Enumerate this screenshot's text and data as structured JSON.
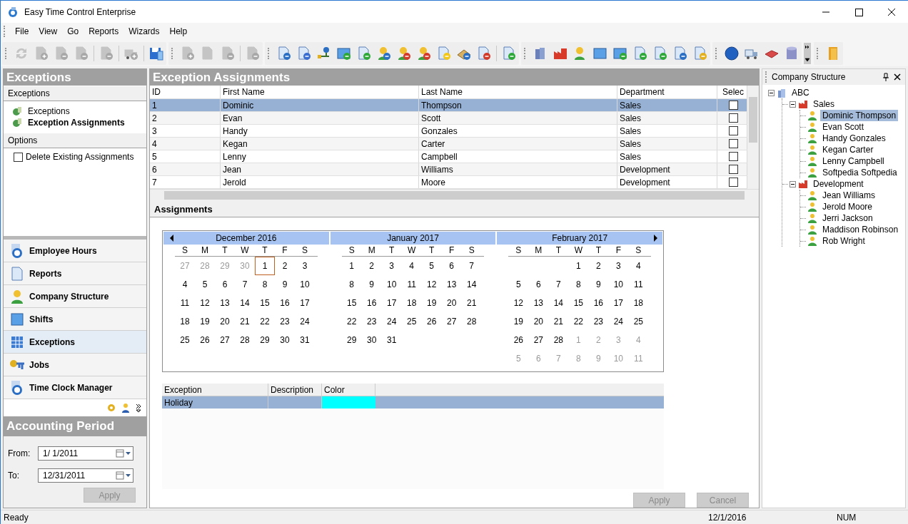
{
  "window": {
    "title": "Easy Time Control Enterprise"
  },
  "menu": [
    "File",
    "View",
    "Go",
    "Reports",
    "Wizards",
    "Help"
  ],
  "left_panel": {
    "title": "Exceptions",
    "sections": [
      {
        "title": "Exceptions",
        "items": [
          {
            "label": "Exceptions",
            "selected": false
          },
          {
            "label": "Exception Assignments",
            "selected": true
          }
        ]
      }
    ],
    "options_title": "Options",
    "options": [
      {
        "label": "Delete Existing Assignments",
        "checked": false
      }
    ],
    "nav": [
      {
        "label": "Employee Hours",
        "kind": "clock",
        "selected": false
      },
      {
        "label": "Reports",
        "kind": "document",
        "selected": false
      },
      {
        "label": "Company Structure",
        "kind": "person",
        "selected": false
      },
      {
        "label": "Shifts",
        "kind": "calendar",
        "selected": false
      },
      {
        "label": "Exceptions",
        "kind": "grid",
        "selected": true
      },
      {
        "label": "Jobs",
        "kind": "key",
        "selected": false
      },
      {
        "label": "Time Clock Manager",
        "kind": "clock",
        "selected": false
      }
    ],
    "accounting": {
      "title": "Accounting Period",
      "from_label": "From:",
      "from": "1/  1/2011",
      "to_label": "To:",
      "to": "12/31/2011",
      "apply": "Apply",
      "apply_disabled": true
    }
  },
  "center": {
    "title": "Exception Assignments",
    "columns": [
      "ID",
      "First Name",
      "Last Name",
      "Department",
      "Selec"
    ],
    "rows": [
      {
        "id": "1",
        "first": "Dominic",
        "last": "Thompson",
        "dept": "Sales",
        "checked": false,
        "selected": true
      },
      {
        "id": "2",
        "first": "Evan",
        "last": "Scott",
        "dept": "Sales",
        "checked": false,
        "selected": false
      },
      {
        "id": "3",
        "first": "Handy",
        "last": "Gonzales",
        "dept": "Sales",
        "checked": false,
        "selected": false
      },
      {
        "id": "4",
        "first": "Kegan",
        "last": "Carter",
        "dept": "Sales",
        "checked": false,
        "selected": false
      },
      {
        "id": "5",
        "first": "Lenny",
        "last": "Campbell",
        "dept": "Sales",
        "checked": false,
        "selected": false
      },
      {
        "id": "6",
        "first": "Jean",
        "last": "Williams",
        "dept": "Development",
        "checked": false,
        "selected": false
      },
      {
        "id": "7",
        "first": "Jerold",
        "last": "Moore",
        "dept": "Development",
        "checked": false,
        "selected": false
      }
    ],
    "assignments_title": "Assignments",
    "months": [
      {
        "title": "December 2016",
        "days": [
          "S",
          "M",
          "T",
          "W",
          "T",
          "F",
          "S"
        ],
        "weeks": [
          [
            {
              "d": "27",
              "other": true,
              "today": false
            },
            {
              "d": "28",
              "other": true,
              "today": false
            },
            {
              "d": "29",
              "other": true,
              "today": false
            },
            {
              "d": "30",
              "other": true,
              "today": false
            },
            {
              "d": "1",
              "other": false,
              "today": true
            },
            {
              "d": "2",
              "other": false,
              "today": false
            },
            {
              "d": "3",
              "other": false,
              "today": false
            }
          ],
          [
            {
              "d": "4",
              "other": false,
              "today": false
            },
            {
              "d": "5",
              "other": false,
              "today": false
            },
            {
              "d": "6",
              "other": false,
              "today": false
            },
            {
              "d": "7",
              "other": false,
              "today": false
            },
            {
              "d": "8",
              "other": false,
              "today": false
            },
            {
              "d": "9",
              "other": false,
              "today": false
            },
            {
              "d": "10",
              "other": false,
              "today": false
            }
          ],
          [
            {
              "d": "11",
              "other": false,
              "today": false
            },
            {
              "d": "12",
              "other": false,
              "today": false
            },
            {
              "d": "13",
              "other": false,
              "today": false
            },
            {
              "d": "14",
              "other": false,
              "today": false
            },
            {
              "d": "15",
              "other": false,
              "today": false
            },
            {
              "d": "16",
              "other": false,
              "today": false
            },
            {
              "d": "17",
              "other": false,
              "today": false
            }
          ],
          [
            {
              "d": "18",
              "other": false,
              "today": false
            },
            {
              "d": "19",
              "other": false,
              "today": false
            },
            {
              "d": "20",
              "other": false,
              "today": false
            },
            {
              "d": "21",
              "other": false,
              "today": false
            },
            {
              "d": "22",
              "other": false,
              "today": false
            },
            {
              "d": "23",
              "other": false,
              "today": false
            },
            {
              "d": "24",
              "other": false,
              "today": false
            }
          ],
          [
            {
              "d": "25",
              "other": false,
              "today": false
            },
            {
              "d": "26",
              "other": false,
              "today": false
            },
            {
              "d": "27",
              "other": false,
              "today": false
            },
            {
              "d": "28",
              "other": false,
              "today": false
            },
            {
              "d": "29",
              "other": false,
              "today": false
            },
            {
              "d": "30",
              "other": false,
              "today": false
            },
            {
              "d": "31",
              "other": false,
              "today": false
            }
          ]
        ]
      },
      {
        "title": "January 2017",
        "days": [
          "S",
          "M",
          "T",
          "W",
          "T",
          "F",
          "S"
        ],
        "weeks": [
          [
            {
              "d": "1",
              "other": false,
              "today": false
            },
            {
              "d": "2",
              "other": false,
              "today": false
            },
            {
              "d": "3",
              "other": false,
              "today": false
            },
            {
              "d": "4",
              "other": false,
              "today": false
            },
            {
              "d": "5",
              "other": false,
              "today": false
            },
            {
              "d": "6",
              "other": false,
              "today": false
            },
            {
              "d": "7",
              "other": false,
              "today": false
            }
          ],
          [
            {
              "d": "8",
              "other": false,
              "today": false
            },
            {
              "d": "9",
              "other": false,
              "today": false
            },
            {
              "d": "10",
              "other": false,
              "today": false
            },
            {
              "d": "11",
              "other": false,
              "today": false
            },
            {
              "d": "12",
              "other": false,
              "today": false
            },
            {
              "d": "13",
              "other": false,
              "today": false
            },
            {
              "d": "14",
              "other": false,
              "today": false
            }
          ],
          [
            {
              "d": "15",
              "other": false,
              "today": false
            },
            {
              "d": "16",
              "other": false,
              "today": false
            },
            {
              "d": "17",
              "other": false,
              "today": false
            },
            {
              "d": "18",
              "other": false,
              "today": false
            },
            {
              "d": "19",
              "other": false,
              "today": false
            },
            {
              "d": "20",
              "other": false,
              "today": false
            },
            {
              "d": "21",
              "other": false,
              "today": false
            }
          ],
          [
            {
              "d": "22",
              "other": false,
              "today": false
            },
            {
              "d": "23",
              "other": false,
              "today": false
            },
            {
              "d": "24",
              "other": false,
              "today": false
            },
            {
              "d": "25",
              "other": false,
              "today": false
            },
            {
              "d": "26",
              "other": false,
              "today": false
            },
            {
              "d": "27",
              "other": false,
              "today": false
            },
            {
              "d": "28",
              "other": false,
              "today": false
            }
          ],
          [
            {
              "d": "29",
              "other": false,
              "today": false
            },
            {
              "d": "30",
              "other": false,
              "today": false
            },
            {
              "d": "31",
              "other": false,
              "today": false
            }
          ]
        ]
      },
      {
        "title": "February 2017",
        "days": [
          "S",
          "M",
          "T",
          "W",
          "T",
          "F",
          "S"
        ],
        "weeks": [
          [
            {
              "d": "1",
              "other": false,
              "today": false
            },
            {
              "d": "2",
              "other": false,
              "today": false
            },
            {
              "d": "3",
              "other": false,
              "today": false
            },
            {
              "d": "4",
              "other": false,
              "today": false
            }
          ],
          [
            {
              "d": "5",
              "other": false,
              "today": false
            },
            {
              "d": "6",
              "other": false,
              "today": false
            },
            {
              "d": "7",
              "other": false,
              "today": false
            },
            {
              "d": "8",
              "other": false,
              "today": false
            },
            {
              "d": "9",
              "other": false,
              "today": false
            },
            {
              "d": "10",
              "other": false,
              "today": false
            },
            {
              "d": "11",
              "other": false,
              "today": false
            }
          ],
          [
            {
              "d": "12",
              "other": false,
              "today": false
            },
            {
              "d": "13",
              "other": false,
              "today": false
            },
            {
              "d": "14",
              "other": false,
              "today": false
            },
            {
              "d": "15",
              "other": false,
              "today": false
            },
            {
              "d": "16",
              "other": false,
              "today": false
            },
            {
              "d": "17",
              "other": false,
              "today": false
            },
            {
              "d": "18",
              "other": false,
              "today": false
            }
          ],
          [
            {
              "d": "19",
              "other": false,
              "today": false
            },
            {
              "d": "20",
              "other": false,
              "today": false
            },
            {
              "d": "21",
              "other": false,
              "today": false
            },
            {
              "d": "22",
              "other": false,
              "today": false
            },
            {
              "d": "23",
              "other": false,
              "today": false
            },
            {
              "d": "24",
              "other": false,
              "today": false
            },
            {
              "d": "25",
              "other": false,
              "today": false
            }
          ],
          [
            {
              "d": "26",
              "other": false,
              "today": false
            },
            {
              "d": "27",
              "other": false,
              "today": false
            },
            {
              "d": "28",
              "other": false,
              "today": false
            },
            {
              "d": "1",
              "other": true,
              "today": false
            },
            {
              "d": "2",
              "other": true,
              "today": false
            },
            {
              "d": "3",
              "other": true,
              "today": false
            },
            {
              "d": "4",
              "other": true,
              "today": false
            }
          ],
          [
            {
              "d": "5",
              "other": true,
              "today": false
            },
            {
              "d": "6",
              "other": true,
              "today": false
            },
            {
              "d": "7",
              "other": true,
              "today": false
            },
            {
              "d": "8",
              "other": true,
              "today": false
            },
            {
              "d": "9",
              "other": true,
              "today": false
            },
            {
              "d": "10",
              "other": true,
              "today": false
            },
            {
              "d": "11",
              "other": true,
              "today": false
            }
          ]
        ]
      }
    ],
    "exception_columns": [
      "Exception",
      "Description",
      "Color"
    ],
    "exceptions": [
      {
        "name": "Holiday",
        "color": "#00ffff",
        "selected": true
      }
    ],
    "buttons": [
      {
        "label": "Apply",
        "disabled": true
      },
      {
        "label": "Cancel",
        "disabled": true
      }
    ]
  },
  "right_panel": {
    "title": "Company Structure",
    "tree": [
      {
        "label": "ABC",
        "kind": "company",
        "expanded": true,
        "selected": false,
        "children": [
          {
            "label": "Sales",
            "kind": "department",
            "expanded": true,
            "selected": false,
            "children": [
              {
                "label": "Dominic Thompson",
                "kind": "employee",
                "selected": true
              },
              {
                "label": "Evan Scott",
                "kind": "employee",
                "selected": false
              },
              {
                "label": "Handy Gonzales",
                "kind": "employee",
                "selected": false
              },
              {
                "label": "Kegan Carter",
                "kind": "employee",
                "selected": false
              },
              {
                "label": "Lenny Campbell",
                "kind": "employee",
                "selected": false
              },
              {
                "label": "Softpedia Softpedia",
                "kind": "employee",
                "selected": false
              }
            ]
          },
          {
            "label": "Development",
            "kind": "department",
            "expanded": true,
            "selected": false,
            "children": [
              {
                "label": "Jean Williams",
                "kind": "employee",
                "selected": false
              },
              {
                "label": "Jerold Moore",
                "kind": "employee",
                "selected": false
              },
              {
                "label": "Jerri Jackson",
                "kind": "employee",
                "selected": false
              },
              {
                "label": "Maddison Robinson",
                "kind": "employee",
                "selected": false
              },
              {
                "label": "Rob Wright",
                "kind": "employee",
                "selected": false
              }
            ]
          }
        ]
      }
    ]
  },
  "status_bar": {
    "status": "Ready",
    "date": "12/1/2016",
    "mode": "NUM"
  }
}
